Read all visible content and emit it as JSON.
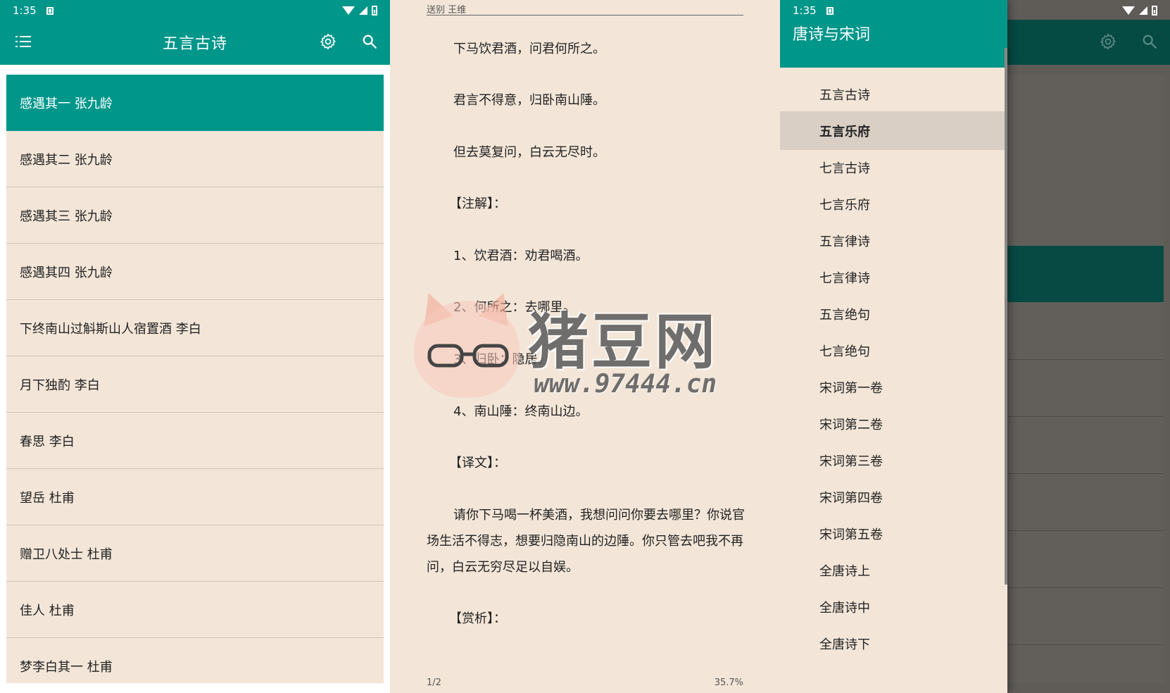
{
  "list_screen": {
    "status_time": "1:35",
    "title": "五言古诗",
    "items": [
      "感遇其一 张九龄",
      "感遇其二 张九龄",
      "感遇其三 张九龄",
      "感遇其四 张九龄",
      "下终南山过斛斯山人宿置酒 李白",
      "月下独酌 李白",
      "春思 李白",
      "望岳 杜甫",
      "赠卫八处士 杜甫",
      "佳人 杜甫",
      "梦李白其一 杜甫"
    ],
    "selected_index": 0,
    "colors": {
      "primary": "#00968a",
      "background": "#f3e6d8"
    }
  },
  "reader": {
    "header": "送别 王维",
    "paragraphs": [
      "下马饮君酒，问君何所之。",
      "君言不得意，归卧南山陲。",
      "但去莫复问，白云无尽时。",
      "【注解】：",
      "1、饮君酒：劝君喝酒。",
      "2、何所之：去哪里。",
      "3、归卧：隐居。",
      "4、南山陲：终南山边。",
      "【译文】：",
      "请你下马喝一杯美酒，我想问问你要去哪里？你说官场生活不得志，想要归隐南山的边陲。你只管去吧我不再问，白云无穷尽足以自娱。",
      "【赏析】："
    ],
    "page": "1/2",
    "progress": "35.7%"
  },
  "watermark": {
    "brand": "猪豆网",
    "url": "www.97444.cn"
  },
  "drawer_screen": {
    "status_time": "1:35",
    "title": "唐诗与宋词",
    "items": [
      "五言古诗",
      "五言乐府",
      "七言古诗",
      "七言乐府",
      "五言律诗",
      "七言律诗",
      "五言绝句",
      "七言绝句",
      "宋词第一卷",
      "宋词第二卷",
      "宋词第三卷",
      "宋词第四卷",
      "宋词第五卷",
      "全唐诗上",
      "全唐诗中",
      "全唐诗下"
    ],
    "selected_index": 1
  }
}
